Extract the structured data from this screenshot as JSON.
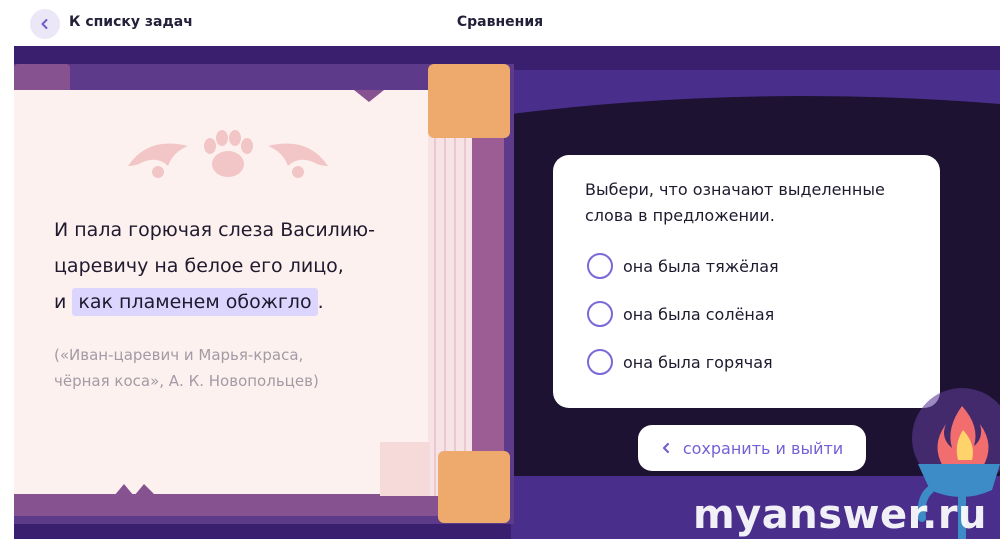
{
  "header": {
    "back_label": "К списку задач",
    "title": "Сравнения"
  },
  "passage": {
    "line1": "И пала горючая слеза Василию-",
    "line2": "царевичу на белое его лицо,",
    "line3_prefix": "и ",
    "highlight": "как пламенем обожгло",
    "line3_suffix": ".",
    "source_line1": "(«Иван-царевич и Марья-краса,",
    "source_line2": "чёрная коса», А. К. Новопольцев)"
  },
  "task": {
    "question": "Выбери, что означают выделенные слова в предложении.",
    "options": [
      "она была тяжёлая",
      "она была солёная",
      "она была горячая"
    ],
    "selected": null
  },
  "actions": {
    "save_exit_label": "сохранить и выйти"
  },
  "watermark": "myanswer.ru",
  "colors": {
    "accent": "#7b68d8",
    "highlight": "#dcd6ff",
    "background_dark": "#3a1f6e",
    "book_corner": "#eeaa6c"
  }
}
